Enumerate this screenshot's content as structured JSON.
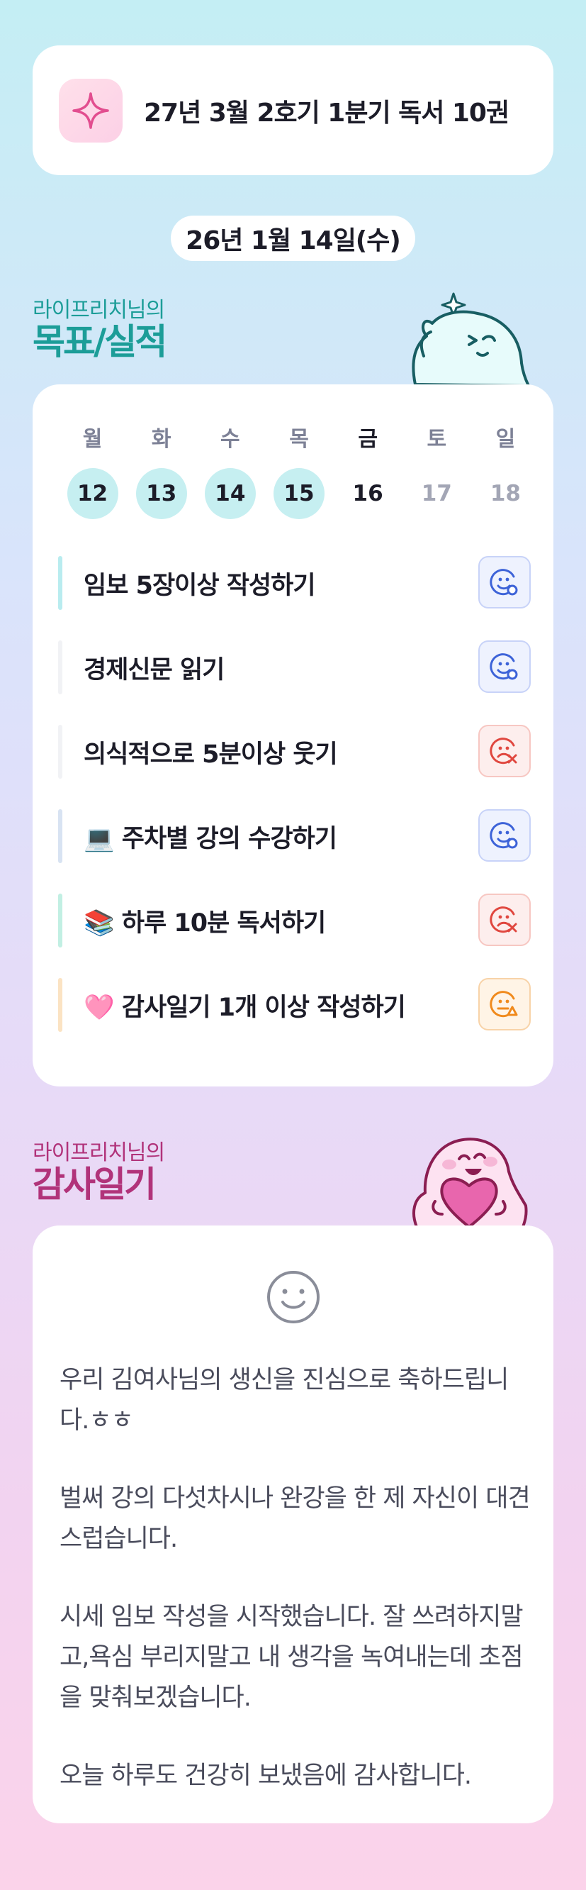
{
  "goal_banner": {
    "text": "27년 3월 2호기 1분기 독서 10권",
    "icon": "sparkle-icon"
  },
  "date": "26년 1월 14일(수)",
  "goals_section": {
    "subtitle": "라이프리치님의",
    "title": "목표/실적"
  },
  "calendar": {
    "weekdays": [
      "월",
      "화",
      "수",
      "목",
      "금",
      "토",
      "일"
    ],
    "days": [
      "12",
      "13",
      "14",
      "15",
      "16",
      "17",
      "18"
    ],
    "today_index": 4
  },
  "goals": [
    {
      "label": "임보 5장이상 작성하기",
      "bar_color": "#b9ecef",
      "status": "smile-icon",
      "status_color": "#3d63d8",
      "status_bg": "#eef2fe",
      "status_border": "#c8d3f8"
    },
    {
      "label": "경제신문 읽기",
      "bar_color": "#f1f2f5",
      "status": "smile-icon",
      "status_color": "#3d63d8",
      "status_bg": "#eef2fe",
      "status_border": "#c8d3f8"
    },
    {
      "label": "의식적으로 5분이상 웃기",
      "bar_color": "#f1f2f5",
      "status": "sad-icon",
      "status_color": "#e0473f",
      "status_bg": "#fdeeed",
      "status_border": "#f7c7c2"
    },
    {
      "label": "💻 주차별 강의 수강하기",
      "bar_color": "#d8e3f2",
      "status": "smile-icon",
      "status_color": "#3d63d8",
      "status_bg": "#eef2fe",
      "status_border": "#c8d3f8"
    },
    {
      "label": "📚 하루 10분 독서하기",
      "bar_color": "#c2efe3",
      "status": "sad-icon",
      "status_color": "#e0473f",
      "status_bg": "#fdeeed",
      "status_border": "#f7c7c2"
    },
    {
      "label": "🩷 감사일기 1개 이상 작성하기",
      "bar_color": "#fbe3c3",
      "status": "neutral-icon",
      "status_color": "#f08a1c",
      "status_bg": "#fff4e6",
      "status_border": "#f8d3a8"
    }
  ],
  "thanks_section": {
    "subtitle": "라이프리치님의",
    "title": "감사일기"
  },
  "diary": [
    "우리 김여사님의 생신을 진심으로 축하드립니다.ㅎㅎ",
    "벌써 강의 다섯차시나 완강을 한 제 자신이 대견스럽습니다.",
    "시세 임보 작성을 시작했습니다. 잘 쓰려하지말고,욕심 부리지말고 내 생각을 녹여내는데 초점을 맞춰보겠습니다.",
    "오늘 하루도 건강히 보냈음에 감사합니다."
  ],
  "colors": {
    "goals_title": "#1c9d98",
    "thanks_title": "#b1337a",
    "smile_face": "#8a8d99"
  }
}
